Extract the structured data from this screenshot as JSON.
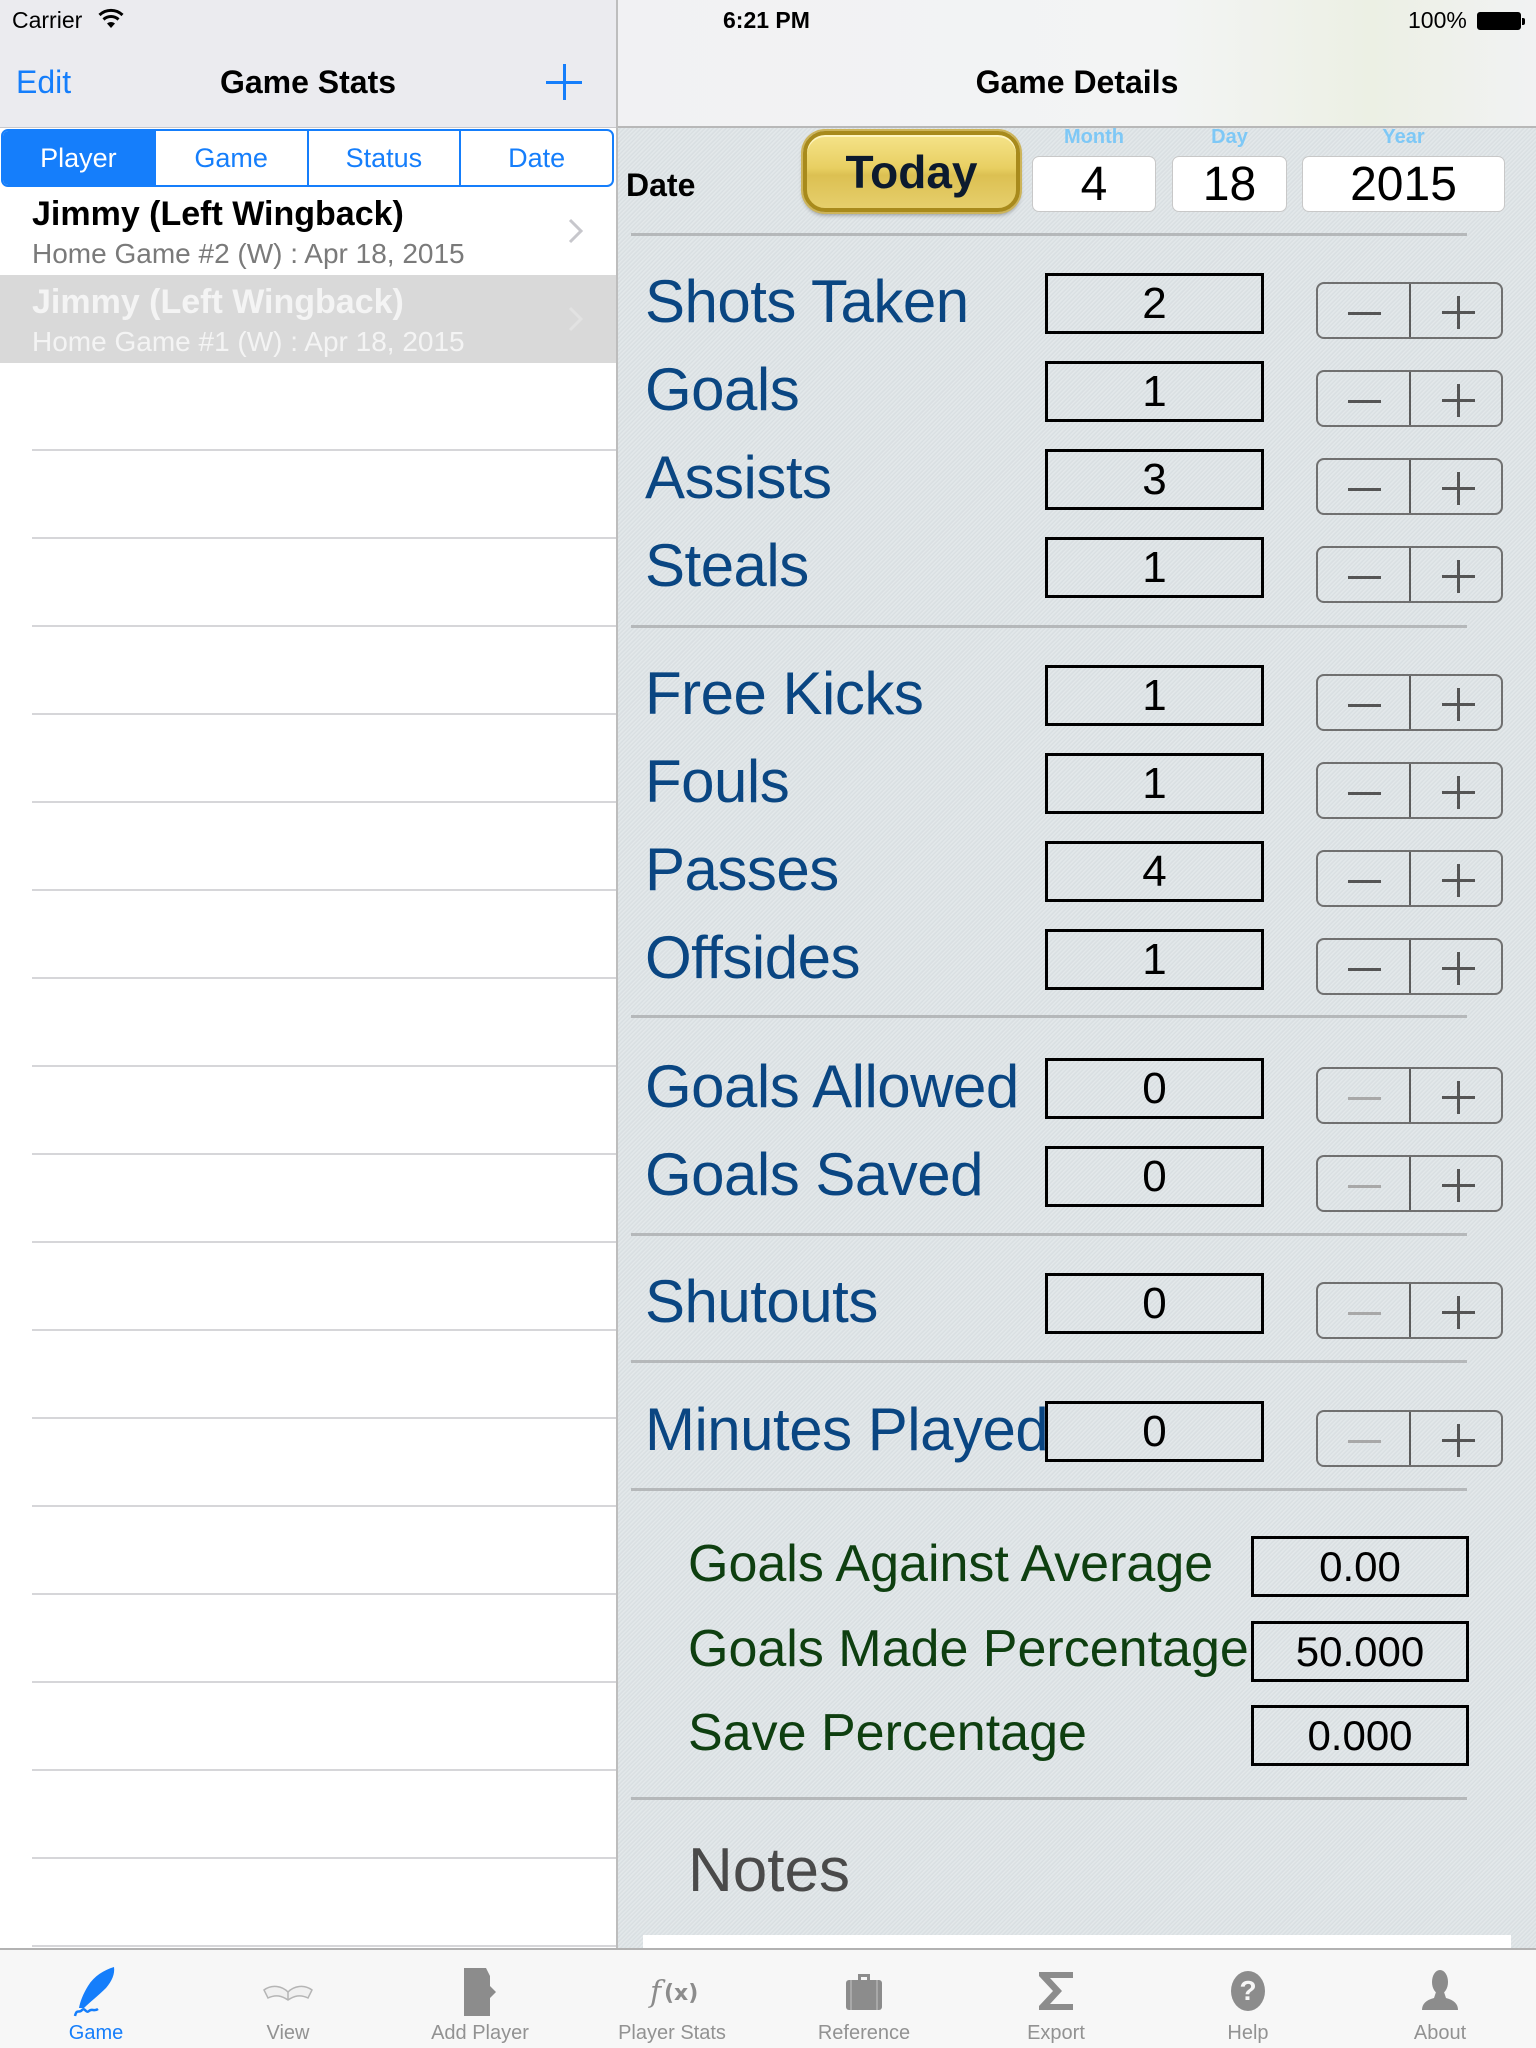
{
  "status_bar": {
    "carrier": "Carrier",
    "time": "6:21 PM",
    "battery": "100%",
    "icons": [
      "wifi-icon",
      "battery-icon"
    ]
  },
  "master": {
    "nav": {
      "edit_label": "Edit",
      "title": "Game Stats",
      "add_icon": "plus-icon"
    },
    "segments": [
      {
        "label": "Player",
        "selected": true
      },
      {
        "label": "Game",
        "selected": false
      },
      {
        "label": "Status",
        "selected": false
      },
      {
        "label": "Date",
        "selected": false
      }
    ],
    "rows": [
      {
        "title": "Jimmy (Left Wingback)",
        "subtitle": "Home Game #2 (W) : Apr 18, 2015",
        "selected": false
      },
      {
        "title": "Jimmy (Left Wingback)",
        "subtitle": "Home Game #1 (W) : Apr 18, 2015",
        "selected": true
      }
    ]
  },
  "detail": {
    "nav": {
      "title": "Game Details"
    },
    "date": {
      "label": "Date",
      "today_button": "Today",
      "month_caption": "Month",
      "day_caption": "Day",
      "year_caption": "Year",
      "month": "4",
      "day": "18",
      "year": "2015"
    },
    "stats": [
      {
        "label": "Shots Taken",
        "value": "2",
        "minus_enabled": true
      },
      {
        "label": "Goals",
        "value": "1",
        "minus_enabled": true
      },
      {
        "label": "Assists",
        "value": "3",
        "minus_enabled": true
      },
      {
        "label": "Steals",
        "value": "1",
        "minus_enabled": true
      },
      {
        "label": "Free Kicks",
        "value": "1",
        "minus_enabled": true
      },
      {
        "label": "Fouls",
        "value": "1",
        "minus_enabled": true
      },
      {
        "label": "Passes",
        "value": "4",
        "minus_enabled": true
      },
      {
        "label": "Offsides",
        "value": "1",
        "minus_enabled": true
      },
      {
        "label": "Goals Allowed",
        "value": "0",
        "minus_enabled": false
      },
      {
        "label": "Goals Saved",
        "value": "0",
        "minus_enabled": false
      },
      {
        "label": "Shutouts",
        "value": "0",
        "minus_enabled": false
      },
      {
        "label": "Minutes Played",
        "value": "0",
        "minus_enabled": false
      }
    ],
    "calculated": [
      {
        "label": "Goals Against Average",
        "value": "0.00"
      },
      {
        "label": "Goals Made Percentage",
        "value": "50.000"
      },
      {
        "label": "Save Percentage",
        "value": "0.000"
      }
    ],
    "notes_label": "Notes",
    "notes_value": "",
    "colors": {
      "stat_label": "#0a4682",
      "calc_label": "#0e3f10",
      "accent": "#157efb",
      "date_caption": "#7ec8f6"
    }
  },
  "tabbar": {
    "tabs": [
      {
        "label": "Game",
        "icon": "quill-pen-icon",
        "active": true
      },
      {
        "label": "View",
        "icon": "open-book-icon",
        "active": false
      },
      {
        "label": "Add Player",
        "icon": "add-player-icon",
        "active": false
      },
      {
        "label": "Player Stats",
        "icon": "function-fx-icon",
        "active": false
      },
      {
        "label": "Reference",
        "icon": "briefcase-icon",
        "active": false
      },
      {
        "label": "Export",
        "icon": "sigma-icon",
        "active": false
      },
      {
        "label": "Help",
        "icon": "question-mark-icon",
        "active": false
      },
      {
        "label": "About",
        "icon": "person-icon",
        "active": false
      }
    ]
  }
}
